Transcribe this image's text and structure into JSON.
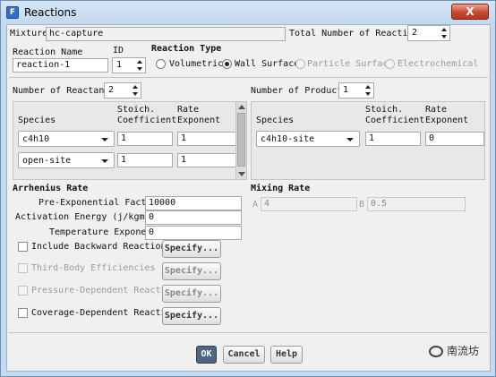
{
  "window": {
    "title": "Reactions",
    "close_label": "X"
  },
  "mixture": {
    "label": "Mixture",
    "value": "hc-capture"
  },
  "total_reactions": {
    "label": "Total Number of Reactions",
    "value": "2"
  },
  "reaction_name": {
    "label": "Reaction Name",
    "value": "reaction-1"
  },
  "id": {
    "label": "ID",
    "value": "1"
  },
  "reaction_type": {
    "label": "Reaction Type",
    "options": [
      "Volumetric",
      "Wall Surface",
      "Particle Surface",
      "Electrochemical"
    ],
    "selected": "Wall Surface"
  },
  "reactants": {
    "count_label": "Number of Reactants",
    "count": "2",
    "headers": {
      "species": "Species",
      "stoich_1": "Stoich.",
      "stoich_2": "Coefficient",
      "rate_1": "Rate",
      "rate_2": "Exponent"
    },
    "rows": [
      {
        "species": "c4h10",
        "stoich": "1",
        "rate": "1"
      },
      {
        "species": "open-site",
        "stoich": "1",
        "rate": "1"
      }
    ]
  },
  "products": {
    "count_label": "Number of Products",
    "count": "1",
    "headers": {
      "species": "Species",
      "stoich_1": "Stoich.",
      "stoich_2": "Coefficient",
      "rate_1": "Rate",
      "rate_2": "Exponent"
    },
    "rows": [
      {
        "species": "c4h10-site",
        "stoich": "1",
        "rate": "0"
      }
    ]
  },
  "arrhenius": {
    "label": "Arrhenius Rate",
    "pre_exp_label": "Pre-Exponential Factor",
    "pre_exp_value": "10000",
    "activation_label": "Activation Energy (j/kgmol)",
    "activation_value": "0",
    "temp_exp_label": "Temperature Exponent",
    "temp_exp_value": "0",
    "options": [
      {
        "label": "Include Backward Reaction",
        "enabled": true,
        "button": "Specify..."
      },
      {
        "label": "Third-Body Efficiencies",
        "enabled": false,
        "button": "Specify..."
      },
      {
        "label": "Pressure-Dependent Reaction",
        "enabled": false,
        "button": "Specify..."
      },
      {
        "label": "Coverage-Dependent Reaction",
        "enabled": true,
        "button": "Specify..."
      }
    ]
  },
  "mixing": {
    "label": "Mixing Rate",
    "a_label": "A",
    "a_value": "4",
    "b_label": "B",
    "b_value": "0.5"
  },
  "buttons": {
    "ok": "OK",
    "cancel": "Cancel",
    "help": "Help"
  },
  "watermark": "南流坊"
}
